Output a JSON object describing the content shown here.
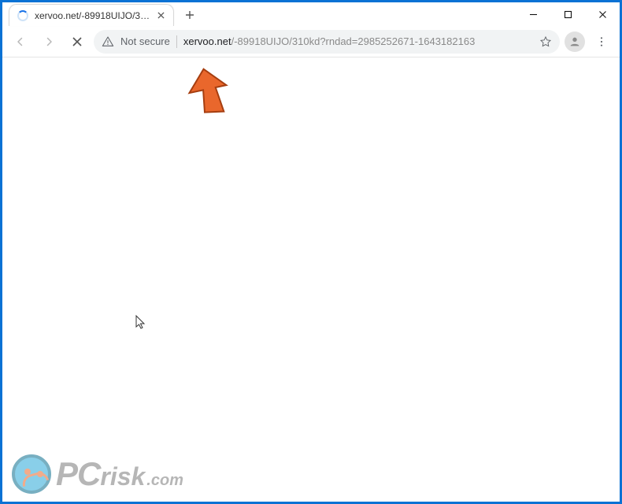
{
  "tab": {
    "title": "xervoo.net/-89918UIJO/310kd?rn"
  },
  "toolbar": {
    "not_secure_label": "Not secure",
    "url_host": "xervoo.net",
    "url_path": "/-89918UIJO/310kd?rndad=2985252671-1643182163"
  },
  "watermark": {
    "part1": "PC",
    "part2": "risk",
    "part3": ".com"
  }
}
